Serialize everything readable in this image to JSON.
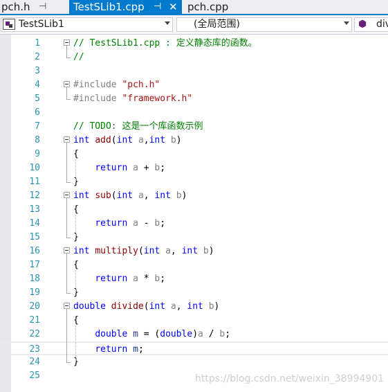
{
  "tabs": [
    {
      "label": "pch.h",
      "pin": "⊣"
    },
    {
      "label": "TestSLib1.cpp",
      "pin": "⊣",
      "close": "✕",
      "active": true
    },
    {
      "label": "pch.cpp"
    }
  ],
  "navbar": {
    "project": "TestSLib1",
    "scope": "(全局范围)",
    "member": "div"
  },
  "code_lines": [
    {
      "n": "1",
      "spans": [
        [
          "c-comment",
          "// TestSLib1.cpp : 定义静态库的函数。"
        ]
      ]
    },
    {
      "n": "2",
      "spans": [
        [
          "c-comment",
          "//"
        ]
      ]
    },
    {
      "n": "3",
      "spans": []
    },
    {
      "n": "4",
      "spans": [
        [
          "c-pp",
          "#include "
        ],
        [
          "c-str",
          "\"pch.h\""
        ]
      ]
    },
    {
      "n": "5",
      "spans": [
        [
          "c-pp",
          "#include "
        ],
        [
          "c-str",
          "\"framework.h\""
        ]
      ]
    },
    {
      "n": "6",
      "spans": []
    },
    {
      "n": "7",
      "spans": [
        [
          "c-comment",
          "// TODO: 这是一个库函数示例"
        ]
      ]
    },
    {
      "n": "8",
      "spans": [
        [
          "c-kw",
          "int"
        ],
        [
          "c-punc",
          " "
        ],
        [
          "c-fn",
          "add"
        ],
        [
          "c-punc",
          "("
        ],
        [
          "c-kw",
          "int"
        ],
        [
          "c-punc",
          " "
        ],
        [
          "c-param",
          "a"
        ],
        [
          "c-punc",
          ","
        ],
        [
          "c-kw",
          "int"
        ],
        [
          "c-punc",
          " "
        ],
        [
          "c-param",
          "b"
        ],
        [
          "c-punc",
          ")"
        ]
      ]
    },
    {
      "n": "9",
      "spans": [
        [
          "c-punc",
          "{"
        ]
      ]
    },
    {
      "n": "10",
      "spans": [
        [
          "c-punc",
          "    "
        ],
        [
          "c-kw",
          "return"
        ],
        [
          "c-punc",
          " "
        ],
        [
          "c-param",
          "a"
        ],
        [
          "c-punc",
          " + "
        ],
        [
          "c-param",
          "b"
        ],
        [
          "c-punc",
          ";"
        ]
      ]
    },
    {
      "n": "11",
      "spans": [
        [
          "c-punc",
          "}"
        ]
      ]
    },
    {
      "n": "12",
      "spans": [
        [
          "c-kw",
          "int"
        ],
        [
          "c-punc",
          " "
        ],
        [
          "c-fn",
          "sub"
        ],
        [
          "c-punc",
          "("
        ],
        [
          "c-kw",
          "int"
        ],
        [
          "c-punc",
          " "
        ],
        [
          "c-param",
          "a"
        ],
        [
          "c-punc",
          ", "
        ],
        [
          "c-kw",
          "int"
        ],
        [
          "c-punc",
          " "
        ],
        [
          "c-param",
          "b"
        ],
        [
          "c-punc",
          ")"
        ]
      ]
    },
    {
      "n": "13",
      "spans": [
        [
          "c-punc",
          "{"
        ]
      ]
    },
    {
      "n": "14",
      "spans": [
        [
          "c-punc",
          "    "
        ],
        [
          "c-kw",
          "return"
        ],
        [
          "c-punc",
          " "
        ],
        [
          "c-param",
          "a"
        ],
        [
          "c-punc",
          " - "
        ],
        [
          "c-param",
          "b"
        ],
        [
          "c-punc",
          ";"
        ]
      ]
    },
    {
      "n": "15",
      "spans": [
        [
          "c-punc",
          "}"
        ]
      ]
    },
    {
      "n": "16",
      "spans": [
        [
          "c-kw",
          "int"
        ],
        [
          "c-punc",
          " "
        ],
        [
          "c-fn",
          "multiply"
        ],
        [
          "c-punc",
          "("
        ],
        [
          "c-kw",
          "int"
        ],
        [
          "c-punc",
          " "
        ],
        [
          "c-param",
          "a"
        ],
        [
          "c-punc",
          ", "
        ],
        [
          "c-kw",
          "int"
        ],
        [
          "c-punc",
          " "
        ],
        [
          "c-param",
          "b"
        ],
        [
          "c-punc",
          ")"
        ]
      ]
    },
    {
      "n": "17",
      "spans": [
        [
          "c-punc",
          "{"
        ]
      ]
    },
    {
      "n": "18",
      "spans": [
        [
          "c-punc",
          "    "
        ],
        [
          "c-kw",
          "return"
        ],
        [
          "c-punc",
          " "
        ],
        [
          "c-param",
          "a"
        ],
        [
          "c-punc",
          " * "
        ],
        [
          "c-param",
          "b"
        ],
        [
          "c-punc",
          ";"
        ]
      ]
    },
    {
      "n": "19",
      "spans": [
        [
          "c-punc",
          "}"
        ]
      ]
    },
    {
      "n": "20",
      "spans": [
        [
          "c-kw",
          "double"
        ],
        [
          "c-punc",
          " "
        ],
        [
          "c-fn",
          "divide"
        ],
        [
          "c-punc",
          "("
        ],
        [
          "c-kw",
          "int"
        ],
        [
          "c-punc",
          " "
        ],
        [
          "c-param",
          "a"
        ],
        [
          "c-punc",
          ", "
        ],
        [
          "c-kw",
          "int"
        ],
        [
          "c-punc",
          " "
        ],
        [
          "c-param",
          "b"
        ],
        [
          "c-punc",
          ")"
        ]
      ]
    },
    {
      "n": "21",
      "spans": [
        [
          "c-punc",
          "{"
        ]
      ]
    },
    {
      "n": "22",
      "spans": [
        [
          "c-punc",
          "    "
        ],
        [
          "c-kw",
          "double"
        ],
        [
          "c-punc",
          " "
        ],
        [
          "c-local",
          "m"
        ],
        [
          "c-punc",
          " = ("
        ],
        [
          "c-kw",
          "double"
        ],
        [
          "c-punc",
          ")"
        ],
        [
          "c-param",
          "a"
        ],
        [
          "c-punc",
          " / "
        ],
        [
          "c-param",
          "b"
        ],
        [
          "c-punc",
          ";"
        ]
      ]
    },
    {
      "n": "23",
      "spans": [
        [
          "c-punc",
          "    "
        ],
        [
          "c-kw",
          "return"
        ],
        [
          "c-punc",
          " "
        ],
        [
          "c-local",
          "m"
        ],
        [
          "c-punc",
          ";"
        ]
      ]
    },
    {
      "n": "24",
      "spans": [
        [
          "c-punc",
          "}"
        ]
      ]
    },
    {
      "n": "25",
      "spans": []
    }
  ],
  "watermark": "https://blog.csdn.net/weixin_38994901"
}
